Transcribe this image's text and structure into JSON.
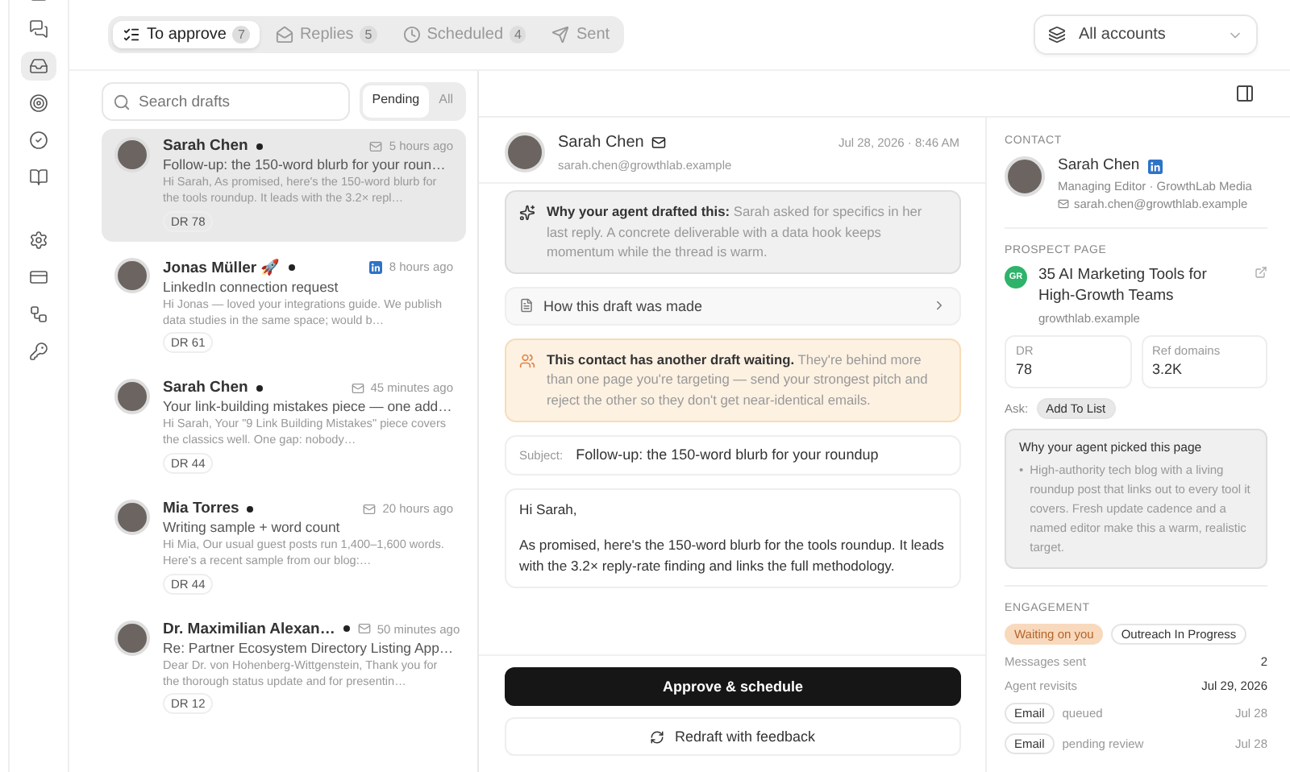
{
  "nav": [
    {
      "selected": false
    },
    {
      "selected": false
    },
    {
      "selected": true
    },
    {
      "selected": false
    },
    {
      "selected": false
    },
    {
      "selected": false
    },
    {
      "selected": false
    },
    {
      "selected": false
    },
    {
      "selected": false
    },
    {
      "selected": false
    }
  ],
  "tabs": [
    {
      "label": "To approve",
      "count": "7",
      "selected": true
    },
    {
      "label": "Replies",
      "count": "5",
      "selected": false
    },
    {
      "label": "Scheduled",
      "count": "4",
      "selected": false
    },
    {
      "label": "Sent",
      "selected": false
    }
  ],
  "account_picker": {
    "value": "All accounts"
  },
  "search": {
    "placeholder": "Search drafts"
  },
  "filter": [
    {
      "label": "Pending",
      "selected": true
    },
    {
      "label": "All",
      "selected": false
    }
  ],
  "drafts": [
    {
      "name": "Sarah Chen",
      "unread": true,
      "kind": "email",
      "time": "5 hours ago",
      "subject": "Follow-up: the 150-word blurb for your roun…",
      "preview": "Hi Sarah, As promised, here's the 150-word blurb for the tools roundup. It leads with the 3.2× repl…",
      "dr": "DR 78",
      "selected": true
    },
    {
      "name": "Jonas Müller 🚀",
      "unread": true,
      "kind": "linkedin",
      "time": "8 hours ago",
      "subject": "LinkedIn connection request",
      "preview": "Hi Jonas — loved your integrations guide. We publish data studies in the same space; would b…",
      "dr": "DR 61",
      "selected": false
    },
    {
      "name": "Sarah Chen",
      "unread": true,
      "kind": "email",
      "time": "45 minutes ago",
      "subject": "Your link-building mistakes piece — one add…",
      "preview": "Hi Sarah, Your \"9 Link Building Mistakes\" piece covers the classics well. One gap: nobody…",
      "dr": "DR 44",
      "selected": false
    },
    {
      "name": "Mia Torres",
      "unread": true,
      "kind": "email",
      "time": "20 hours ago",
      "subject": "Writing sample + word count",
      "preview": "Hi Mia, Our usual guest posts run 1,400–1,600 words. Here's a recent sample from our blog:…",
      "dr": "DR 44",
      "selected": false
    },
    {
      "name": "Dr. Maximilian Alexan…",
      "unread": true,
      "kind": "email",
      "time": "50 minutes ago",
      "subject": "Re: Partner Ecosystem Directory Listing App…",
      "preview": "Dear Dr. von Hohenberg-Wittgenstein, Thank you for the thorough status update and for presentin…",
      "dr": "DR 12",
      "selected": false
    }
  ],
  "detail": {
    "name": "Sarah Chen",
    "email": "sarah.chen@growthlab.example",
    "date": "Jul 28, 2026 · 8:46 AM",
    "reason": "**Why your agent drafted this:** Sarah asked for specifics in her last reply. A concrete deliverable with a data hook keeps momentum while the thread is warm.",
    "how_made": "How this draft was made",
    "warning": "**This contact has another draft waiting.** They're behind more than one page you're targeting — send your strongest pitch and reject the other so they don't get near-identical emails.",
    "subject_label": "Subject:",
    "subject": "Follow-up: the 150-word blurb for your roundup",
    "body": [
      "Hi Sarah,",
      "As promised, here's the 150-word blurb for the tools roundup. It leads with the 3.2× reply-rate finding and links the full methodology."
    ],
    "approve": "Approve & schedule",
    "redraft": "Redraft with feedback"
  },
  "contact": {
    "heading": "CONTACT",
    "name": "Sarah Chen",
    "role": "Managing Editor · GrowthLab Media",
    "email": "sarah.chen@growthlab.example"
  },
  "prospect": {
    "heading": "PROSPECT PAGE",
    "badge": "GR",
    "title": "35 AI Marketing Tools for High-Growth Teams",
    "domain": "growthlab.example",
    "metrics": [
      {
        "label": "DR",
        "value": "78"
      },
      {
        "label": "Ref domains",
        "value": "3.2K"
      }
    ],
    "ask_label": "Ask:",
    "ask": "Add To List",
    "why_title": "Why your agent picked this page",
    "why_marker": "•",
    "why_points": [
      "High-authority tech blog with a living roundup post that links out to every tool it covers. Fresh update cadence and a named editor make this a warm, realistic target."
    ]
  },
  "engagement": {
    "heading": "ENGAGEMENT",
    "badges": [
      {
        "label": "Waiting on you",
        "kind": "warning"
      },
      {
        "label": "Outreach In Progress",
        "kind": "neutral"
      }
    ],
    "stats": [
      {
        "label": "Messages sent",
        "value": "2"
      },
      {
        "label": "Agent revisits",
        "value": "Jul 29, 2026"
      }
    ],
    "events": [
      {
        "channel": "Email",
        "status": "queued",
        "date": "Jul 28"
      },
      {
        "channel": "Email",
        "status": "pending review",
        "date": "Jul 28"
      }
    ]
  }
}
